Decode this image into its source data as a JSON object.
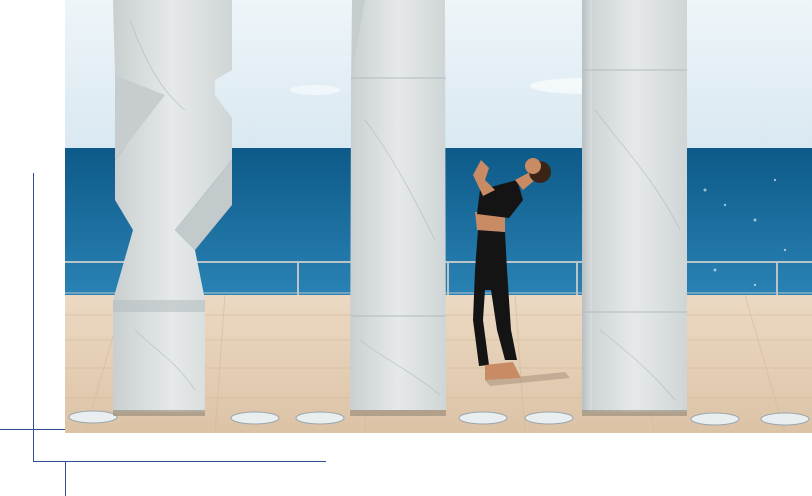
{
  "image": {
    "subject": "yoga-pose-between-marble-columns",
    "colors": {
      "sky_top": "#eaf3f8",
      "sky_bottom": "#dbe9f2",
      "sea_dark": "#0f5f8f",
      "sea_light": "#2c86b7",
      "deck": "#e8d5bf",
      "deck_line": "#d6bfa4",
      "marble": "#dfe3e3",
      "marble_shadow": "#bfc6c7",
      "accent_line": "#2f4f8f"
    }
  }
}
